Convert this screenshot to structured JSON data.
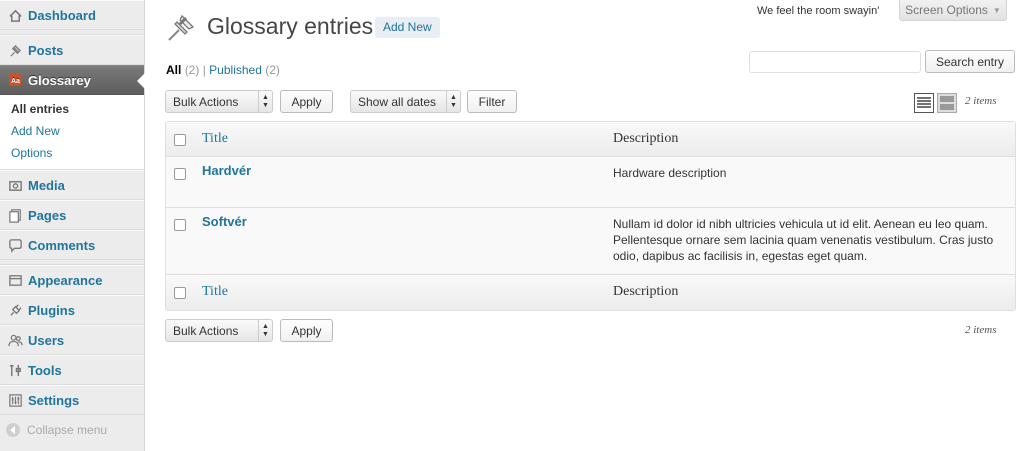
{
  "sidebar": {
    "items": [
      {
        "label": "Dashboard",
        "icon": "dashboard-icon"
      },
      {
        "label": "Posts",
        "icon": "pushpin-icon"
      },
      {
        "label": "Glossarey",
        "icon": "glossary-icon"
      },
      {
        "label": "Media",
        "icon": "media-icon"
      },
      {
        "label": "Pages",
        "icon": "pages-icon"
      },
      {
        "label": "Comments",
        "icon": "comment-icon"
      },
      {
        "label": "Appearance",
        "icon": "appearance-icon"
      },
      {
        "label": "Plugins",
        "icon": "plugin-icon"
      },
      {
        "label": "Users",
        "icon": "users-icon"
      },
      {
        "label": "Tools",
        "icon": "tools-icon"
      },
      {
        "label": "Settings",
        "icon": "settings-icon"
      }
    ],
    "submenu": [
      "All entries",
      "Add New",
      "Options"
    ],
    "collapse_label": "Collapse menu"
  },
  "header": {
    "tagline": "We feel the room swayin'",
    "screen_options": "Screen Options"
  },
  "page": {
    "title": "Glossary entries",
    "add_new": "Add New"
  },
  "views": {
    "all_label": "All",
    "all_count": "(2)",
    "separator": "|",
    "published_label": "Published",
    "published_count": "(2)"
  },
  "search": {
    "value": "",
    "button": "Search entry"
  },
  "tablenav_top": {
    "bulk_actions": "Bulk Actions",
    "apply": "Apply",
    "dates": "Show all dates",
    "filter": "Filter",
    "items": "2 items"
  },
  "tablenav_bottom": {
    "bulk_actions": "Bulk Actions",
    "apply": "Apply",
    "items": "2 items"
  },
  "table": {
    "columns": [
      "Title",
      "Description"
    ],
    "rows": [
      {
        "title": "Hardvér",
        "description": "Hardware description"
      },
      {
        "title": "Softvér",
        "description": "Nullam id dolor id nibh ultricies vehicula ut id elit. Aenean eu leo quam. Pellentesque ornare sem lacinia quam venenatis vestibulum. Cras justo odio, dapibus ac facilisis in, egestas eget quam."
      }
    ]
  },
  "colors": {
    "link": "#21759b",
    "sidebar_current": "#6d6d6d"
  }
}
